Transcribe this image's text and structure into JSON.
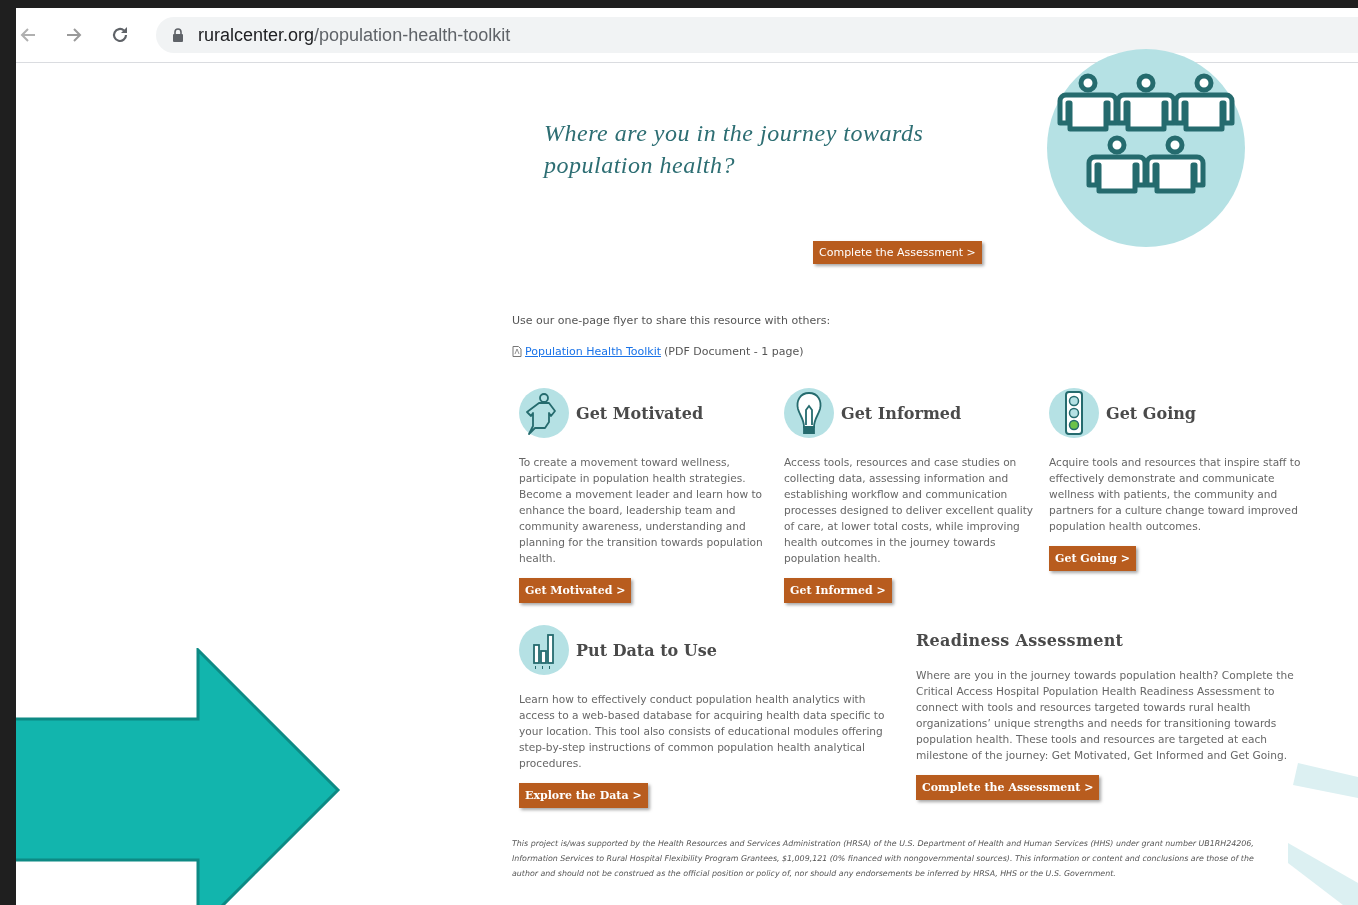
{
  "browser": {
    "url_host": "ruralcenter.org",
    "url_path": "/population-health-toolkit"
  },
  "hero": {
    "heading": "Where are you in the journey towards population health?",
    "button": "Complete the Assessment >"
  },
  "flyer": {
    "intro": "Use our one-page flyer to share this resource with others:",
    "link": "Population Health Toolkit",
    "note": "(PDF Document - 1 page)"
  },
  "sections": [
    {
      "kind": "motivated",
      "title": "Get Motivated",
      "body": "To create a movement toward wellness, participate in population health strategies. Become a movement leader and learn how to enhance the board, leadership team and community awareness, understanding and planning for the transition towards population health.",
      "button": "Get Motivated >"
    },
    {
      "kind": "informed",
      "title": "Get Informed",
      "body": "Access tools, resources and case studies on collecting data, assessing information and establishing workflow and communication processes designed to deliver excellent quality of care, at lower total costs, while improving health outcomes in the journey towards population health.",
      "button": "Get Informed >"
    },
    {
      "kind": "going",
      "title": "Get Going",
      "body": "Acquire tools and resources that inspire staff to effectively demonstrate and communicate wellness with patients, the community and partners for a culture change toward improved population health outcomes.",
      "button": "Get Going >"
    },
    {
      "kind": "data",
      "title": "Put Data to Use",
      "body": "Learn how to effectively conduct population health analytics with access to a web-based database for acquiring health data specific to your location. This tool also consists of educational modules offering step-by-step instructions of common population health analytical procedures.",
      "button": "Explore the Data >"
    }
  ],
  "readiness": {
    "title": "Readiness Assessment",
    "body": "Where are you in the journey towards population health? Complete the Critical Access Hospital Population Health Readiness Assessment to connect with tools and resources targeted towards rural health organizations’ unique strengths and needs for transitioning towards population health. These tools and resources are targeted at each milestone of the journey: Get Motivated, Get Informed and Get Going.",
    "button": "Complete the Assessment >"
  },
  "footer": "This project is/was supported by the Health Resources and Services Administration (HRSA) of the U.S. Department of Health and Human Services (HHS) under grant number UB1RH24206, Information Services to Rural Hospital Flexibility Program Grantees, $1,009,121 (0% financed with nongovernmental sources). This information or content and conclusions are those of the author and should not be construed as the official position or policy of, nor should any endorsements be inferred by HRSA, HHS or the U.S. Government."
}
